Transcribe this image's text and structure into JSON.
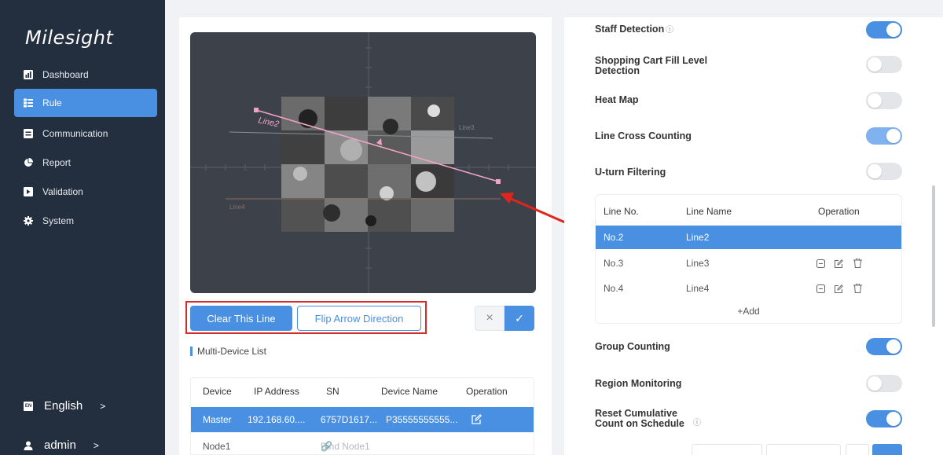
{
  "sidebar": {
    "logo": "Milesight",
    "items": [
      {
        "label": "Dashboard",
        "icon": "bar-chart-icon"
      },
      {
        "label": "Rule",
        "icon": "rule-list-icon"
      },
      {
        "label": "Communication",
        "icon": "communication-icon"
      },
      {
        "label": "Report",
        "icon": "pie-chart-icon"
      },
      {
        "label": "Validation",
        "icon": "validation-icon"
      },
      {
        "label": "System",
        "icon": "gear-icon"
      }
    ],
    "language": "English",
    "user": "admin"
  },
  "video": {
    "lines": [
      "Line2",
      "Line3",
      "Line4"
    ]
  },
  "controls": {
    "clear_line": "Clear This Line",
    "flip_arrow": "Flip Arrow Direction",
    "cancel_symbol": "×",
    "confirm_symbol": "✓"
  },
  "multi_device": {
    "title": "Multi-Device List",
    "headers": [
      "Device",
      "IP Address",
      "SN",
      "Device Name",
      "Operation"
    ],
    "rows": [
      {
        "device": "Master",
        "ip": "192.168.60....",
        "sn": "6757D1617...",
        "name": "P35555555555..."
      }
    ],
    "node": {
      "device": "Node1",
      "action": "Bind Node1"
    }
  },
  "features": [
    {
      "label": "Staff Detection",
      "state": "on",
      "info": "ⓘ"
    },
    {
      "label": "Shopping Cart Fill Level Detection",
      "state": "off"
    },
    {
      "label": "Heat Map",
      "state": "off"
    },
    {
      "label": "Line Cross Counting",
      "state": "on-light"
    },
    {
      "label": "U-turn Filtering",
      "state": "off"
    }
  ],
  "line_table": {
    "headers": [
      "Line No.",
      "Line Name",
      "Operation"
    ],
    "rows": [
      {
        "no": "No.2",
        "name": "Line2"
      },
      {
        "no": "No.3",
        "name": "Line3"
      },
      {
        "no": "No.4",
        "name": "Line4"
      }
    ],
    "add": "+Add"
  },
  "features_lower": [
    {
      "label": "Group Counting",
      "state": "on"
    },
    {
      "label": "Region Monitoring",
      "state": "off"
    },
    {
      "label": "Reset Cumulative Count on Schedule",
      "state": "on",
      "info": "ⓘ"
    }
  ],
  "colors": {
    "accent": "#4a90e2",
    "sidebar_bg": "#232f3e",
    "highlight_red": "#d62b2b"
  }
}
